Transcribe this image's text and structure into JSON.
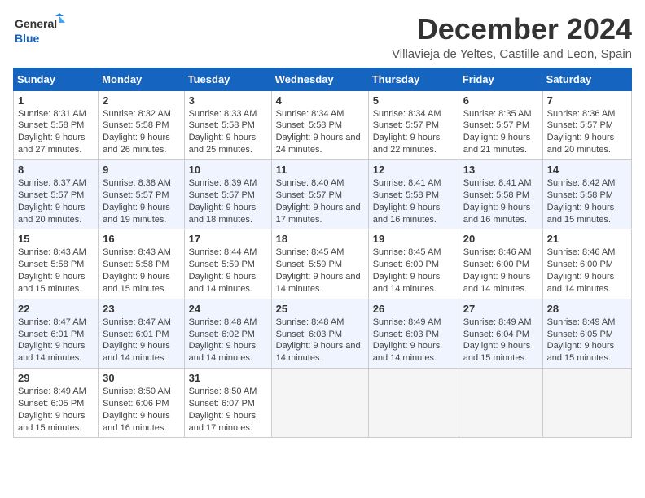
{
  "logo": {
    "line1": "General",
    "line2": "Blue"
  },
  "title": "December 2024",
  "subtitle": "Villavieja de Yeltes, Castille and Leon, Spain",
  "days_of_week": [
    "Sunday",
    "Monday",
    "Tuesday",
    "Wednesday",
    "Thursday",
    "Friday",
    "Saturday"
  ],
  "weeks": [
    [
      {
        "day": "1",
        "sunrise": "8:31 AM",
        "sunset": "5:58 PM",
        "daylight": "9 hours and 27 minutes."
      },
      {
        "day": "2",
        "sunrise": "8:32 AM",
        "sunset": "5:58 PM",
        "daylight": "9 hours and 26 minutes."
      },
      {
        "day": "3",
        "sunrise": "8:33 AM",
        "sunset": "5:58 PM",
        "daylight": "9 hours and 25 minutes."
      },
      {
        "day": "4",
        "sunrise": "8:34 AM",
        "sunset": "5:58 PM",
        "daylight": "9 hours and 24 minutes."
      },
      {
        "day": "5",
        "sunrise": "8:34 AM",
        "sunset": "5:57 PM",
        "daylight": "9 hours and 22 minutes."
      },
      {
        "day": "6",
        "sunrise": "8:35 AM",
        "sunset": "5:57 PM",
        "daylight": "9 hours and 21 minutes."
      },
      {
        "day": "7",
        "sunrise": "8:36 AM",
        "sunset": "5:57 PM",
        "daylight": "9 hours and 20 minutes."
      }
    ],
    [
      {
        "day": "8",
        "sunrise": "8:37 AM",
        "sunset": "5:57 PM",
        "daylight": "9 hours and 20 minutes."
      },
      {
        "day": "9",
        "sunrise": "8:38 AM",
        "sunset": "5:57 PM",
        "daylight": "9 hours and 19 minutes."
      },
      {
        "day": "10",
        "sunrise": "8:39 AM",
        "sunset": "5:57 PM",
        "daylight": "9 hours and 18 minutes."
      },
      {
        "day": "11",
        "sunrise": "8:40 AM",
        "sunset": "5:57 PM",
        "daylight": "9 hours and 17 minutes."
      },
      {
        "day": "12",
        "sunrise": "8:41 AM",
        "sunset": "5:58 PM",
        "daylight": "9 hours and 16 minutes."
      },
      {
        "day": "13",
        "sunrise": "8:41 AM",
        "sunset": "5:58 PM",
        "daylight": "9 hours and 16 minutes."
      },
      {
        "day": "14",
        "sunrise": "8:42 AM",
        "sunset": "5:58 PM",
        "daylight": "9 hours and 15 minutes."
      }
    ],
    [
      {
        "day": "15",
        "sunrise": "8:43 AM",
        "sunset": "5:58 PM",
        "daylight": "9 hours and 15 minutes."
      },
      {
        "day": "16",
        "sunrise": "8:43 AM",
        "sunset": "5:58 PM",
        "daylight": "9 hours and 15 minutes."
      },
      {
        "day": "17",
        "sunrise": "8:44 AM",
        "sunset": "5:59 PM",
        "daylight": "9 hours and 14 minutes."
      },
      {
        "day": "18",
        "sunrise": "8:45 AM",
        "sunset": "5:59 PM",
        "daylight": "9 hours and 14 minutes."
      },
      {
        "day": "19",
        "sunrise": "8:45 AM",
        "sunset": "6:00 PM",
        "daylight": "9 hours and 14 minutes."
      },
      {
        "day": "20",
        "sunrise": "8:46 AM",
        "sunset": "6:00 PM",
        "daylight": "9 hours and 14 minutes."
      },
      {
        "day": "21",
        "sunrise": "8:46 AM",
        "sunset": "6:00 PM",
        "daylight": "9 hours and 14 minutes."
      }
    ],
    [
      {
        "day": "22",
        "sunrise": "8:47 AM",
        "sunset": "6:01 PM",
        "daylight": "9 hours and 14 minutes."
      },
      {
        "day": "23",
        "sunrise": "8:47 AM",
        "sunset": "6:01 PM",
        "daylight": "9 hours and 14 minutes."
      },
      {
        "day": "24",
        "sunrise": "8:48 AM",
        "sunset": "6:02 PM",
        "daylight": "9 hours and 14 minutes."
      },
      {
        "day": "25",
        "sunrise": "8:48 AM",
        "sunset": "6:03 PM",
        "daylight": "9 hours and 14 minutes."
      },
      {
        "day": "26",
        "sunrise": "8:49 AM",
        "sunset": "6:03 PM",
        "daylight": "9 hours and 14 minutes."
      },
      {
        "day": "27",
        "sunrise": "8:49 AM",
        "sunset": "6:04 PM",
        "daylight": "9 hours and 15 minutes."
      },
      {
        "day": "28",
        "sunrise": "8:49 AM",
        "sunset": "6:05 PM",
        "daylight": "9 hours and 15 minutes."
      }
    ],
    [
      {
        "day": "29",
        "sunrise": "8:49 AM",
        "sunset": "6:05 PM",
        "daylight": "9 hours and 15 minutes."
      },
      {
        "day": "30",
        "sunrise": "8:50 AM",
        "sunset": "6:06 PM",
        "daylight": "9 hours and 16 minutes."
      },
      {
        "day": "31",
        "sunrise": "8:50 AM",
        "sunset": "6:07 PM",
        "daylight": "9 hours and 17 minutes."
      },
      null,
      null,
      null,
      null
    ]
  ],
  "labels": {
    "sunrise": "Sunrise:",
    "sunset": "Sunset:",
    "daylight": "Daylight:"
  }
}
